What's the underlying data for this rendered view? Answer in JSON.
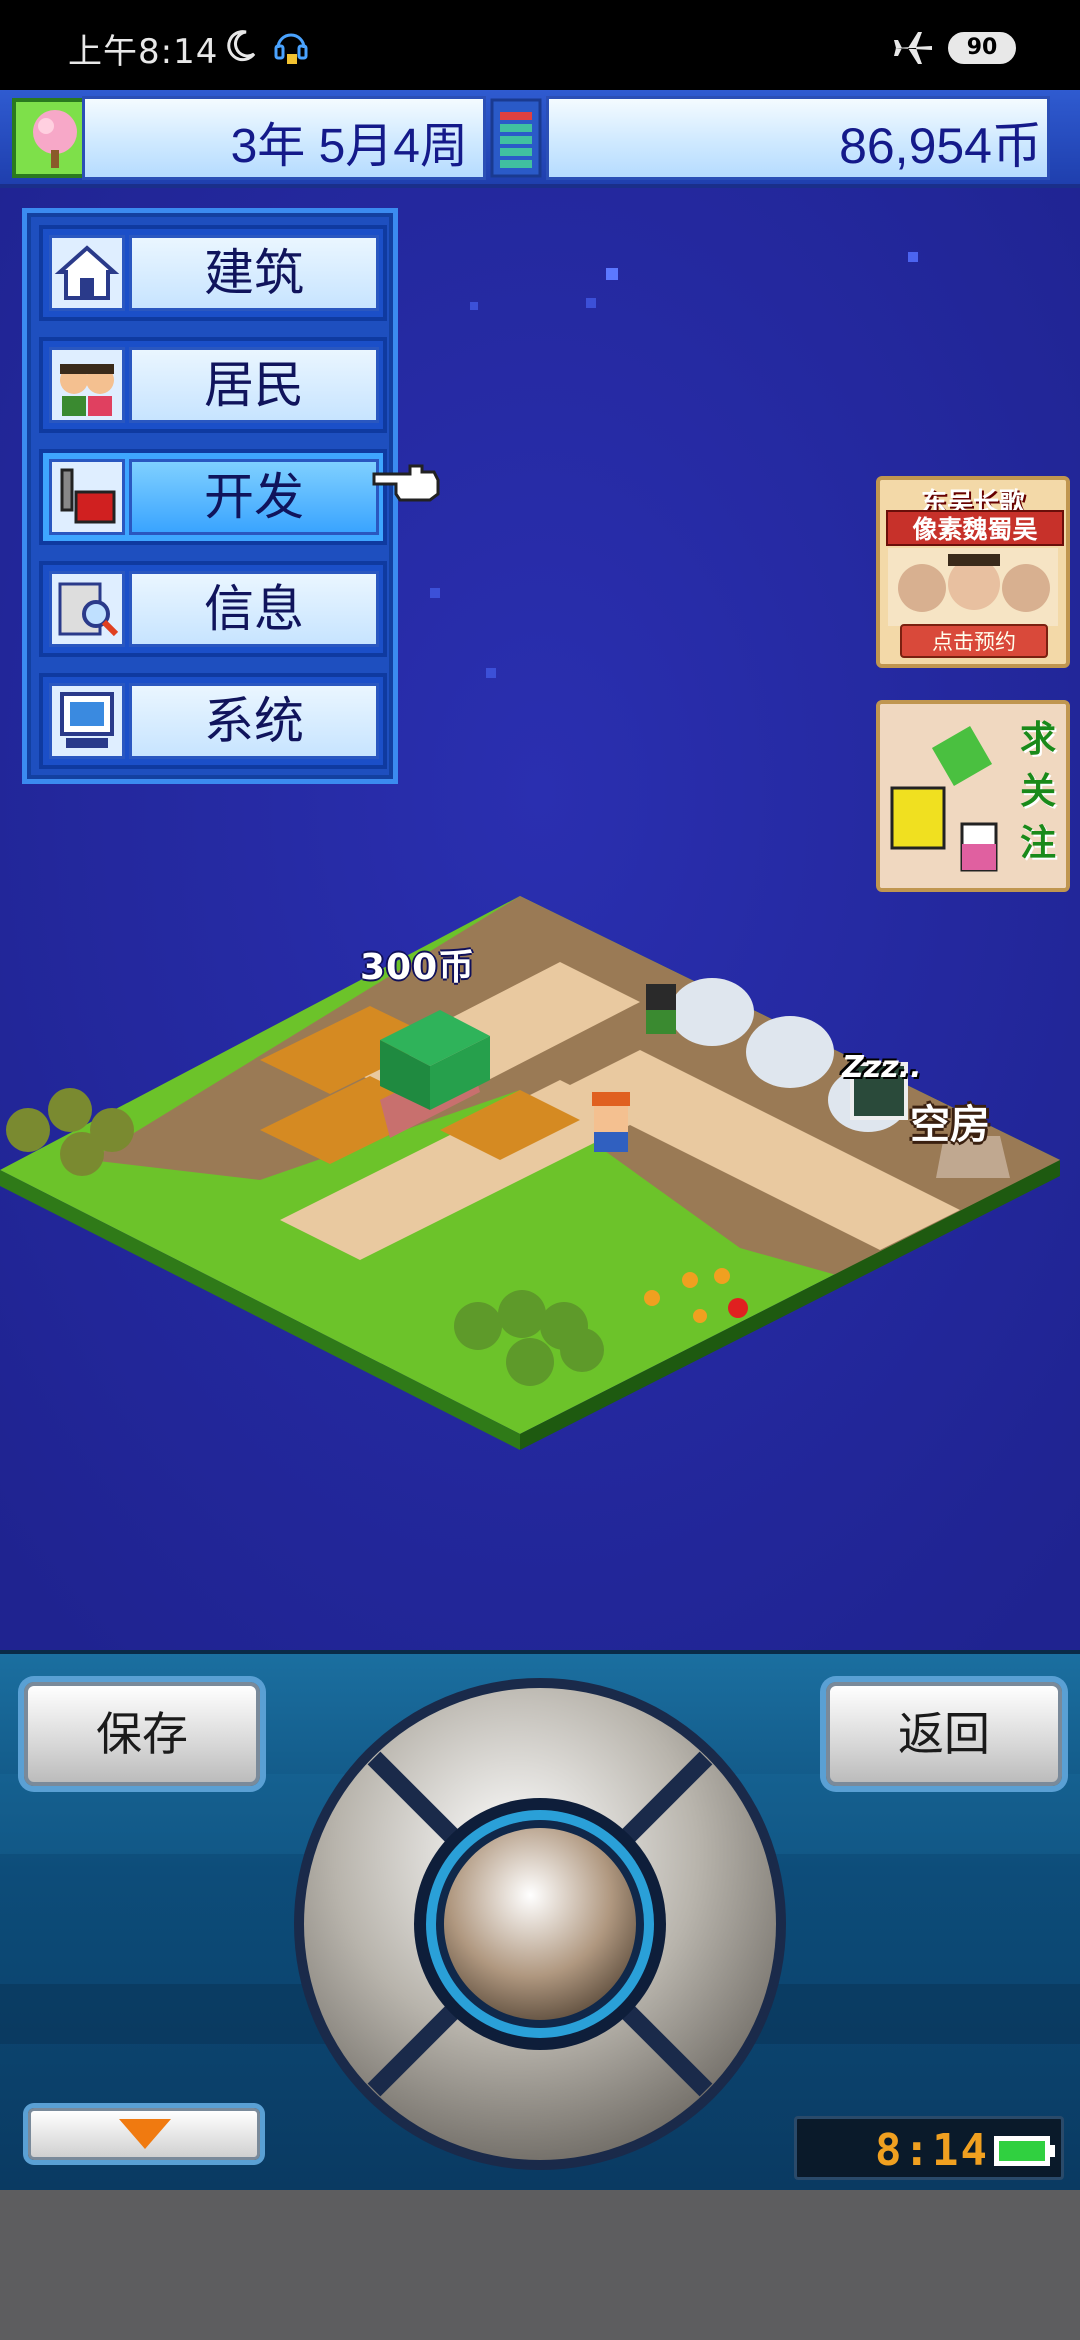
{
  "status_bar": {
    "time": "上午8:14",
    "battery": "90",
    "icons": [
      "moon-icon",
      "headset-icon",
      "airplane-icon"
    ]
  },
  "top_bar": {
    "date": "3年 5月4周",
    "money": "86,954币",
    "icons": [
      "tree-icon",
      "wallet-icon"
    ]
  },
  "menu": {
    "items": [
      {
        "label": "建筑",
        "icon": "house-icon",
        "active": false
      },
      {
        "label": "居民",
        "icon": "residents-icon",
        "active": false
      },
      {
        "label": "开发",
        "icon": "develop-icon",
        "active": true
      },
      {
        "label": "信息",
        "icon": "info-search-icon",
        "active": false
      },
      {
        "label": "系统",
        "icon": "computer-icon",
        "active": false
      }
    ]
  },
  "ads": {
    "ad1": {
      "title": "东吴长歌",
      "subtitle": "像素魏蜀吴",
      "button": "点击预约"
    },
    "ad2": {
      "text": "求关注"
    }
  },
  "scene": {
    "price_tag": "300币",
    "sleep_tag": "Zzz..",
    "vacant_tag": "空房"
  },
  "controller": {
    "save_label": "保存",
    "back_label": "返回",
    "clock": "8:14"
  },
  "colors": {
    "sky": "#23279a",
    "menu_blue": "#1e4fbf",
    "label_text": "#10145c",
    "clock_text": "#f0a020"
  }
}
